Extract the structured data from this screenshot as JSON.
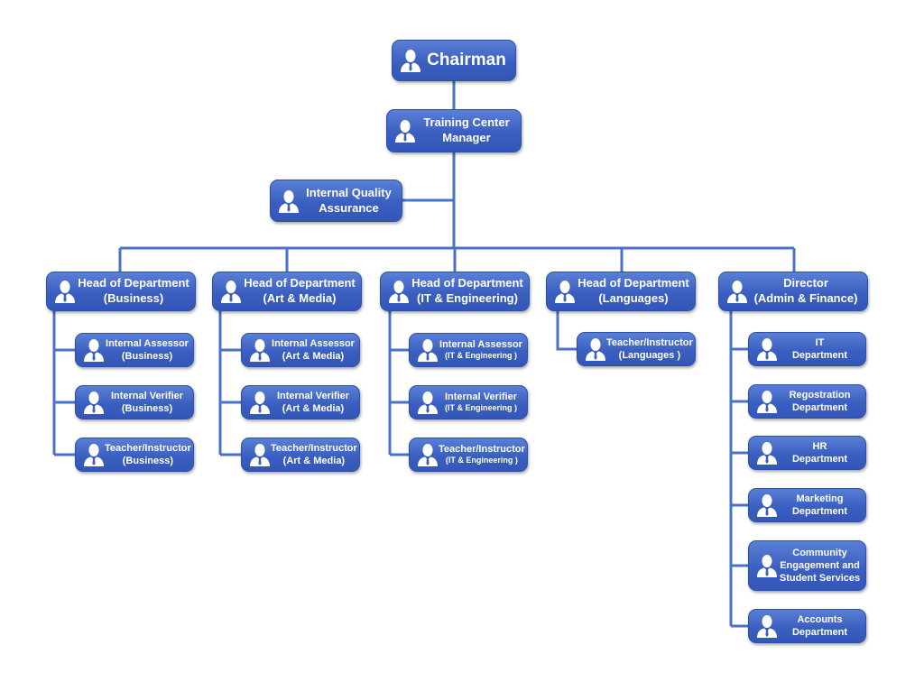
{
  "colors": {
    "node": "#3b5fc0",
    "line": "#4a72c8"
  },
  "icon": "person-icon",
  "chairman": [
    "Chairman"
  ],
  "manager": [
    "Training Center",
    "Manager"
  ],
  "quality": [
    "Internal Quality",
    "Assurance"
  ],
  "heads": [
    {
      "l": [
        "Head of Department",
        "(Business)"
      ]
    },
    {
      "l": [
        "Head of Department",
        "(Art & Media)"
      ]
    },
    {
      "l": [
        "Head of Department",
        "(IT & Engineering)"
      ]
    },
    {
      "l": [
        "Head of Department",
        "(Languages)"
      ]
    },
    {
      "l": [
        "Director",
        "(Admin & Finance)"
      ]
    }
  ],
  "business": [
    [
      "Internal Assessor",
      "(Business)"
    ],
    [
      "Internal Verifier",
      "(Business)"
    ],
    [
      "Teacher/Instructor",
      "(Business)"
    ]
  ],
  "art": [
    [
      "Internal Assessor",
      "(Art & Media)"
    ],
    [
      "Internal Verifier",
      "(Art & Media)"
    ],
    [
      "Teacher/Instructor",
      "(Art & Media)"
    ]
  ],
  "it": [
    [
      "Internal Assessor",
      "(IT & Engineering )"
    ],
    [
      "Internal Verifier",
      "(IT & Engineering )"
    ],
    [
      "Teacher/Instructor",
      "(IT & Engineering )"
    ]
  ],
  "lang": [
    [
      "Teacher/Instructor",
      "(Languages )"
    ]
  ],
  "admin": [
    [
      "IT",
      "Department"
    ],
    [
      "Regostration",
      "Department"
    ],
    [
      "HR",
      "Department"
    ],
    [
      "Marketing",
      "Department"
    ],
    [
      "Community",
      "Engagement and",
      "Student Services"
    ],
    [
      "Accounts",
      "Department"
    ]
  ]
}
